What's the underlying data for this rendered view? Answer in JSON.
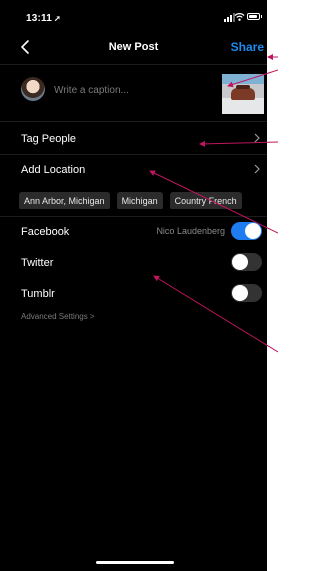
{
  "status_bar": {
    "time": "13:11",
    "time_arrow": "➚"
  },
  "header": {
    "title": "New Post",
    "share_label": "Share"
  },
  "caption": {
    "placeholder": "Write a caption..."
  },
  "rows": {
    "tag_people": "Tag People",
    "add_location": "Add Location"
  },
  "location_suggestions": [
    "Ann Arbor, Michigan",
    "Michigan",
    "Country French"
  ],
  "share_targets": {
    "facebook": {
      "label": "Facebook",
      "account": "Nico Laudenberg",
      "enabled": true
    },
    "twitter": {
      "label": "Twitter",
      "enabled": false
    },
    "tumblr": {
      "label": "Tumblr",
      "enabled": false
    }
  },
  "advanced_settings": "Advanced Settings >",
  "colors": {
    "accent": "#1a8cf0",
    "toggle_on": "#1e7cf0",
    "annotation": "#c0155f"
  }
}
